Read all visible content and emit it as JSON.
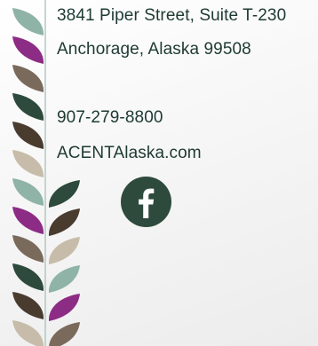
{
  "contact": {
    "street": "3841 Piper Street, Suite T-230",
    "city_state_zip": "Anchorage, Alaska 99508",
    "phone": "907-279-8800",
    "website": "ACENTAlaska.com"
  },
  "social": {
    "facebook_icon": "facebook-icon"
  },
  "colors": {
    "text": "#1e3a33",
    "stem": "#a9c1ba",
    "leaf_sage": "#8fb4a7",
    "leaf_magenta": "#8d2c84",
    "leaf_taupe": "#7a6a5c",
    "leaf_forest": "#2d4a3c",
    "leaf_brown": "#4a3b2f",
    "leaf_beige": "#c7bca9",
    "facebook_circle": "#2d4a3c"
  }
}
